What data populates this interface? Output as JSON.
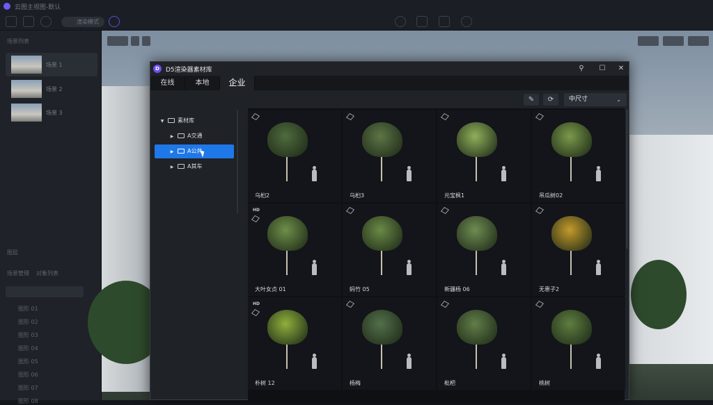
{
  "app": {
    "title": "云图主视图-默认",
    "toolbar_pill": "渲染模式",
    "left_panel": {
      "scenes_header": "场景列表",
      "scenes": [
        "场景 1",
        "场景 2",
        "场景 3"
      ],
      "layers_header": "图层",
      "outliner_header": "场景管理",
      "outliner_sub": "对象列表",
      "items": [
        "图形 01",
        "图形 02",
        "图形 03",
        "图形 04",
        "图形 05",
        "图形 06",
        "图形 07",
        "图形 08"
      ]
    }
  },
  "dialog": {
    "logo": "D",
    "title": "D5渲染器素材库",
    "tabs": [
      {
        "label": "在线",
        "active": false
      },
      {
        "label": "本地",
        "active": false
      },
      {
        "label": "企业",
        "active": true
      }
    ],
    "tool_icons": [
      "pencil-icon",
      "refresh-icon"
    ],
    "size_select": {
      "value": "中尺寸",
      "icon": "chevron-down-icon"
    },
    "tree": {
      "root": "素材库",
      "children": [
        {
          "label": "A交通",
          "selected": false
        },
        {
          "label": "A公共",
          "selected": true
        },
        {
          "label": "A其车",
          "selected": false
        }
      ]
    },
    "assets": [
      {
        "name": "乌桕2",
        "hd": false,
        "color": "#4f6b3e"
      },
      {
        "name": "乌桕3",
        "hd": false,
        "color": "#5d7546"
      },
      {
        "name": "元宝枫1",
        "hd": false,
        "color": "#8fb05a"
      },
      {
        "name": "吊瓜树02",
        "hd": false,
        "color": "#7a9a4a"
      },
      {
        "name": "大叶女贞 01",
        "hd": true,
        "color": "#6e8f48"
      },
      {
        "name": "蚂竹 05",
        "hd": false,
        "color": "#6a8a45"
      },
      {
        "name": "新疆杨 06",
        "hd": false,
        "color": "#6f8c52"
      },
      {
        "name": "无患子2",
        "hd": false,
        "color": "#c49a2a"
      },
      {
        "name": "朴树 12",
        "hd": true,
        "color": "#8fb03c"
      },
      {
        "name": "杨梅",
        "hd": false,
        "color": "#53704a"
      },
      {
        "name": "枇杷",
        "hd": false,
        "color": "#617e48"
      },
      {
        "name": "桃树",
        "hd": false,
        "color": "#5e7e40"
      }
    ]
  }
}
